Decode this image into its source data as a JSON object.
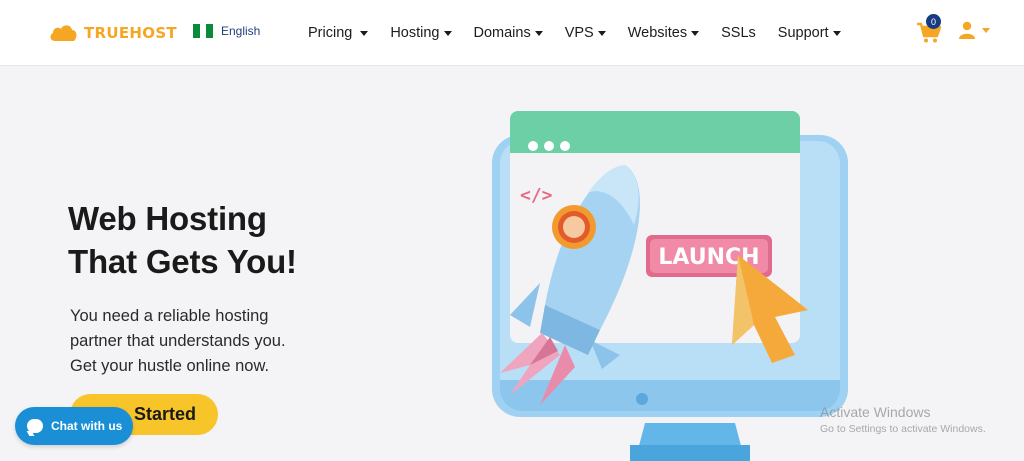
{
  "header": {
    "logo_text": "TRUEHOST",
    "language": "English",
    "nav": [
      {
        "label": "Pricing"
      },
      {
        "label": "Hosting"
      },
      {
        "label": "Domains"
      },
      {
        "label": "VPS"
      },
      {
        "label": "Websites"
      },
      {
        "label": "SSLs"
      },
      {
        "label": "Support"
      }
    ],
    "cart_count": "0"
  },
  "hero": {
    "title_line1": "Web Hosting",
    "title_line2": "That Gets You!",
    "subtitle_line1": "You need a reliable hosting",
    "subtitle_line2": "partner that understands you.",
    "subtitle_line3": "Get your hustle online now.",
    "cta_label": "Started"
  },
  "illustration": {
    "button_text": "LAUNCH",
    "code_tag": "</>"
  },
  "chat": {
    "label": "Chat with us"
  },
  "watermark": {
    "title": "Activate Windows",
    "subtitle": "Go to Settings to activate Windows."
  },
  "colors": {
    "brand": "#f5a623",
    "cta": "#f7c52a",
    "chat": "#1a8fd6",
    "badge": "#173b82"
  }
}
